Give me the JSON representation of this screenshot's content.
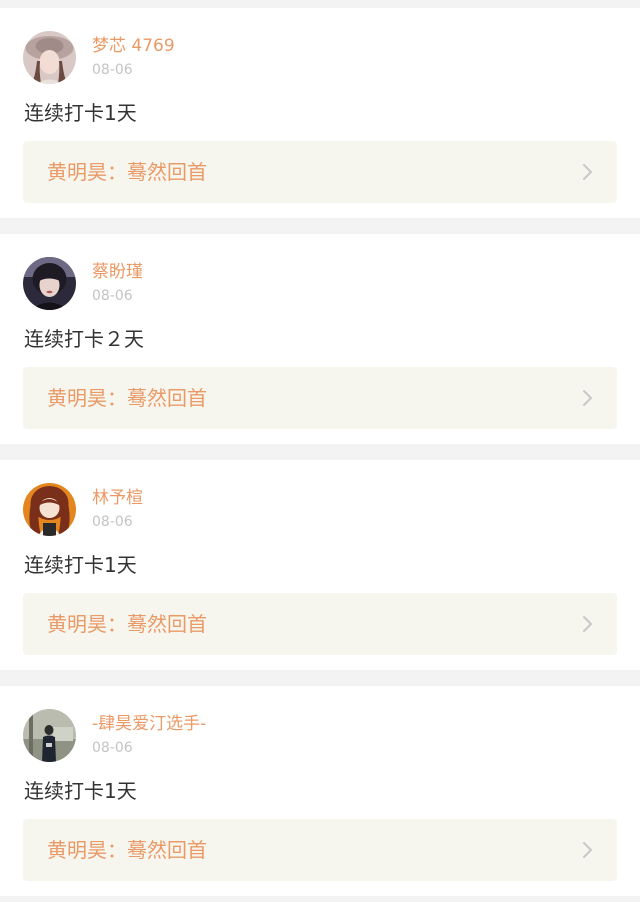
{
  "posts": [
    {
      "username": "梦芯 4769",
      "date": "08-06",
      "checkin_text": "连续打卡1天",
      "song_label": "黄明昊：蓦然回首",
      "avatar_icon": "user-avatar-girl-hat"
    },
    {
      "username": "蔡盼瑾",
      "date": "08-06",
      "checkin_text": "连续打卡２天",
      "song_label": "黄明昊：蓦然回首",
      "avatar_icon": "user-avatar-girl-dark"
    },
    {
      "username": "林予楦",
      "date": "08-06",
      "checkin_text": "连续打卡1天",
      "song_label": "黄明昊：蓦然回首",
      "avatar_icon": "user-avatar-anime-girl"
    },
    {
      "username": "-肆昊爱汀选手-",
      "date": "08-06",
      "checkin_text": "连续打卡1天",
      "song_label": "黄明昊：蓦然回首",
      "avatar_icon": "user-avatar-street-photo"
    }
  ],
  "colors": {
    "accent": "#ea9a66",
    "date": "#c4c4c4",
    "body_text": "#333333",
    "song_box_bg": "#f6f6ef",
    "page_bg": "#f3f3f3"
  }
}
